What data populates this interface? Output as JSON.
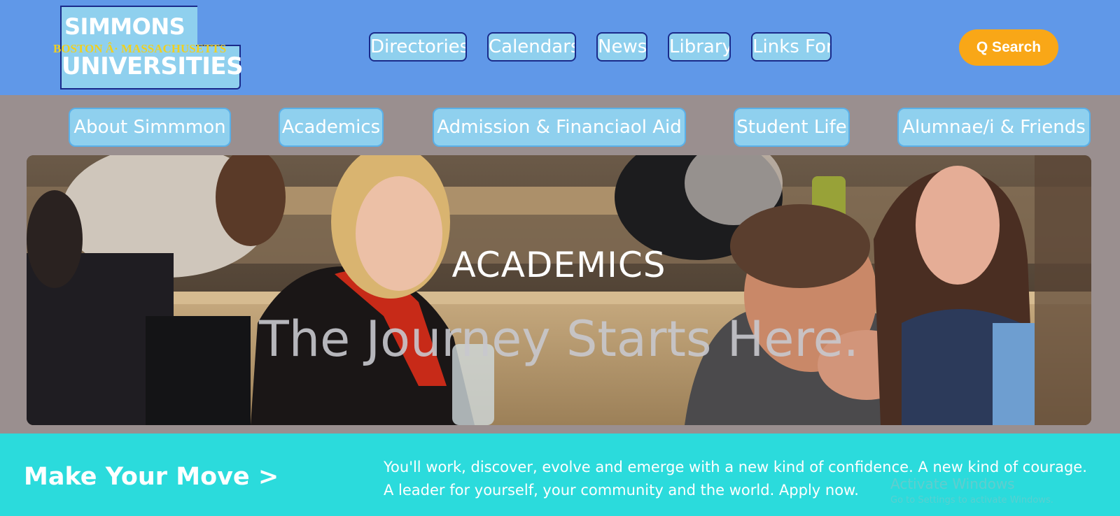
{
  "logo": {
    "name_top": "SIMMONS",
    "subtitle": "BOSTON Â· MASSACHUSETTS",
    "name_bottom": "UNIVERSITIES"
  },
  "top_nav": [
    {
      "label": "Directories"
    },
    {
      "label": "Calendars"
    },
    {
      "label": "News"
    },
    {
      "label": "Library"
    },
    {
      "label": "Links For"
    }
  ],
  "search": {
    "label": "Q Search"
  },
  "main_nav": [
    {
      "label": "About Simmmon"
    },
    {
      "label": "Academics"
    },
    {
      "label": "Admission & Financiaol Aid"
    },
    {
      "label": "Student Life"
    },
    {
      "label": "Alumnae/i & Friends"
    }
  ],
  "hero": {
    "kicker": "ACADEMICS",
    "title": "The Journey Starts Here."
  },
  "cta": {
    "title": "Make Your Move >",
    "text": "You'll work, discover, evolve and emerge with a new kind of confidence. A new kind of courage. A leader for yourself, your community and the world. Apply now."
  },
  "watermark": {
    "title": "Activate Windows",
    "subtitle": "Go to Settings to activate Windows."
  },
  "colors": {
    "header_bg": "#6098e8",
    "nav_button_bg": "#8fd0ee",
    "nav_border": "#1a2a8a",
    "search_bg": "#f9a717",
    "page_bg": "#9a8f8f",
    "cta_bg": "#2bdbdc",
    "logo_subtitle": "#f0d020"
  }
}
